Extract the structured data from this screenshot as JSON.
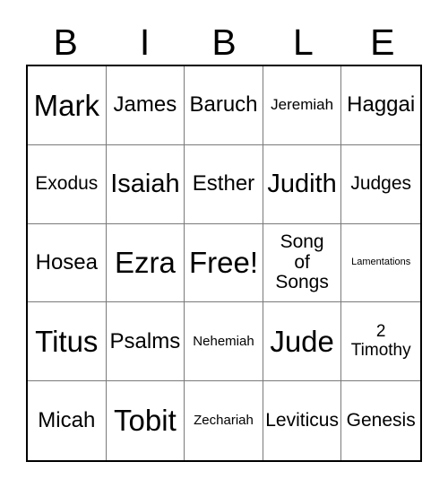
{
  "card": {
    "title_letters": [
      "B",
      "I",
      "B",
      "L",
      "E"
    ],
    "free_space_label": "Free!",
    "grid_size": "5x5",
    "colors": {
      "background": "#ffffff",
      "text": "#000000",
      "outer_border": "#000000",
      "inner_grid_line": "#7a7a7a"
    }
  },
  "rows": [
    {
      "cells": [
        {
          "text": "Mark",
          "size": "xxl"
        },
        {
          "text": "James",
          "size": "l"
        },
        {
          "text": "Baruch",
          "size": "l"
        },
        {
          "text": "Jeremiah",
          "size": "s"
        },
        {
          "text": "Haggai",
          "size": "l"
        }
      ]
    },
    {
      "cells": [
        {
          "text": "Exodus",
          "size": "m"
        },
        {
          "text": "Isaiah",
          "size": "xl"
        },
        {
          "text": "Esther",
          "size": "l"
        },
        {
          "text": "Judith",
          "size": "xl"
        },
        {
          "text": "Judges",
          "size": "m"
        }
      ]
    },
    {
      "cells": [
        {
          "text": "Hosea",
          "size": "l"
        },
        {
          "text": "Ezra",
          "size": "xxl"
        },
        {
          "text": "Free!",
          "size": "xxl"
        },
        {
          "text": "Song\nof\nSongs",
          "size": "multi"
        },
        {
          "text": "Lamentations",
          "size": "xxs"
        }
      ]
    },
    {
      "cells": [
        {
          "text": "Titus",
          "size": "xxl"
        },
        {
          "text": "Psalms",
          "size": "l"
        },
        {
          "text": "Nehemiah",
          "size": "xs"
        },
        {
          "text": "Jude",
          "size": "xxl"
        },
        {
          "text": "2\nTimothy",
          "size": "multi-sm"
        }
      ]
    },
    {
      "cells": [
        {
          "text": "Micah",
          "size": "l"
        },
        {
          "text": "Tobit",
          "size": "xxl"
        },
        {
          "text": "Zechariah",
          "size": "xs"
        },
        {
          "text": "Leviticus",
          "size": "m"
        },
        {
          "text": "Genesis",
          "size": "m"
        }
      ]
    }
  ]
}
